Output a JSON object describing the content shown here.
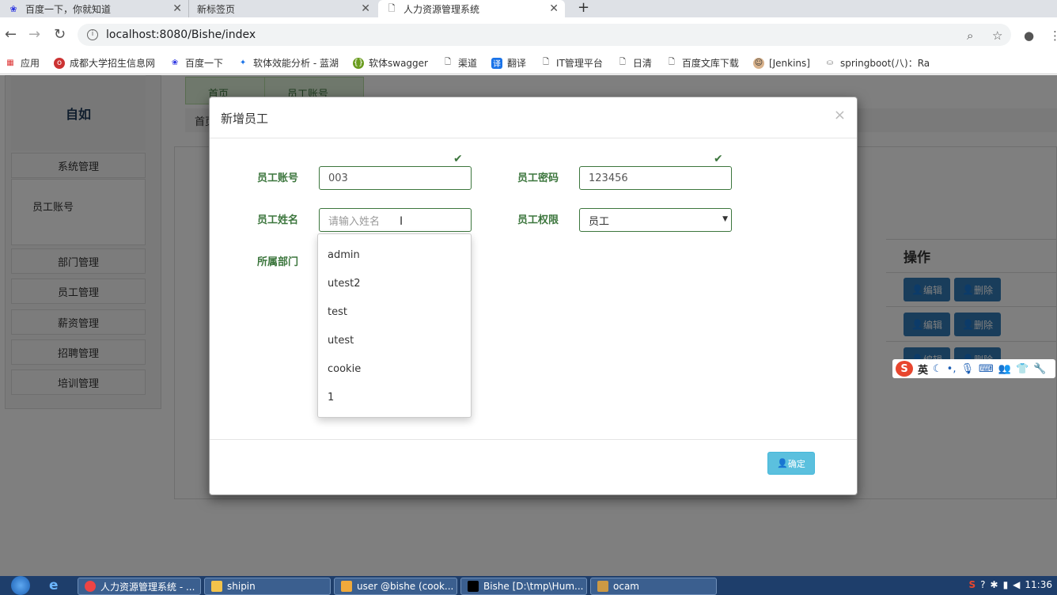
{
  "browser": {
    "tabs": [
      {
        "title": "百度一下，你就知道",
        "icon": "baidu-paw-icon"
      },
      {
        "title": "新标签页",
        "icon": "blank-page-icon"
      },
      {
        "title": "人力资源管理系统",
        "icon": "page-icon"
      }
    ],
    "url": "localhost:8080/Bishe/index",
    "bookmarks": [
      "应用",
      "成都大学招生信息网",
      "百度一下",
      "软体效能分析 - 蓝湖",
      "软体swagger",
      "渠道",
      "翻译",
      "IT管理平台",
      "日清",
      "百度文库下载",
      "[Jenkins]",
      "springboot(八)：Ra"
    ]
  },
  "page": {
    "logo": "自如",
    "menu": [
      "系统管理",
      "部门管理",
      "员工管理",
      "薪资管理",
      "招聘管理",
      "培训管理"
    ],
    "submenu_item": "员工账号",
    "main_tabs": [
      "首页",
      "员工账号"
    ],
    "breadcrumb": "首页",
    "ops_header": "操作",
    "edit_label": "编辑",
    "delete_label": "删除"
  },
  "modal": {
    "title": "新增员工",
    "close": "×",
    "account_label": "员工账号",
    "account_value": "003",
    "password_label": "员工密码",
    "password_value": "123456",
    "name_label": "员工姓名",
    "name_placeholder": "请输入姓名",
    "permission_label": "员工权限",
    "permission_value": "员工",
    "department_label": "所属部门",
    "autocomplete": [
      "admin",
      "utest2",
      "test",
      "utest",
      "cookie",
      "1"
    ],
    "confirm_label": "确定"
  },
  "ime": {
    "lang": "英"
  },
  "taskbar": {
    "items": [
      "人力资源管理系统 - ...",
      "shipin",
      "user @bishe (cook...",
      "Bishe [D:\\tmp\\Hum...",
      "ocam"
    ],
    "clock": "11:36"
  }
}
